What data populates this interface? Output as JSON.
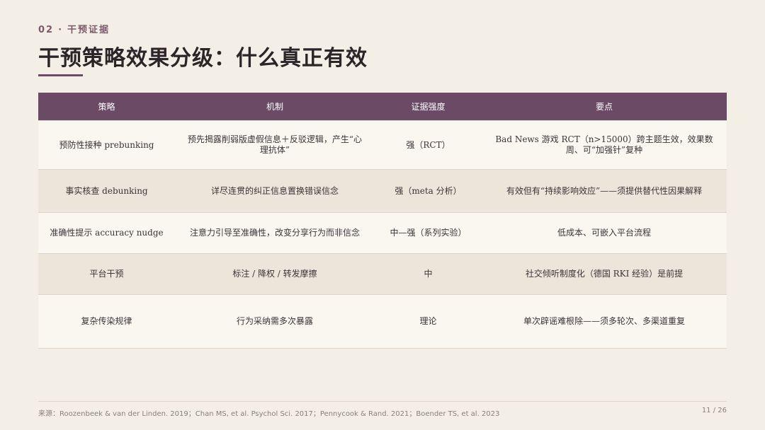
{
  "section": {
    "number": "02",
    "separator": "·",
    "label": "干预证据"
  },
  "title": "干预策略效果分级：什么真正有效",
  "table": {
    "headers": [
      "策略",
      "机制",
      "证据强度",
      "要点"
    ],
    "rows": [
      {
        "strategy": "预防性接种 prebunking",
        "mechanism": "预先揭露削弱版虚假信息＋反驳逻辑，产生“心理抗体”",
        "evidence": "强（RCT）",
        "key": "Bad News 游戏 RCT（n>15000）跨主题生效，效果数周、可“加强针”复种"
      },
      {
        "strategy": "事实核查 debunking",
        "mechanism": "详尽连贯的纠正信息置换错误信念",
        "evidence": "强（meta 分析）",
        "key": "有效但有“持续影响效应”——须提供替代性因果解释"
      },
      {
        "strategy": "准确性提示 accuracy nudge",
        "mechanism": "注意力引导至准确性，改变分享行为而非信念",
        "evidence": "中—强（系列实验）",
        "key": "低成本、可嵌入平台流程"
      },
      {
        "strategy": "平台干预",
        "mechanism": "标注 / 降权 / 转发摩擦",
        "evidence": "中",
        "key": "社交倾听制度化（德国 RKI 经验）是前提"
      },
      {
        "strategy": "复杂传染规律",
        "mechanism": "行为采纳需多次暴露",
        "evidence": "理论",
        "key": "单次辟谣难根除——须多轮次、多渠道重复"
      }
    ]
  },
  "footer": {
    "source": "来源：Roozenbeek & van der Linden. 2019；Chan MS, et al. Psychol Sci. 2017；Pennycook & Rand. 2021；Boender TS, et al. 2023",
    "page": "11 / 26"
  }
}
